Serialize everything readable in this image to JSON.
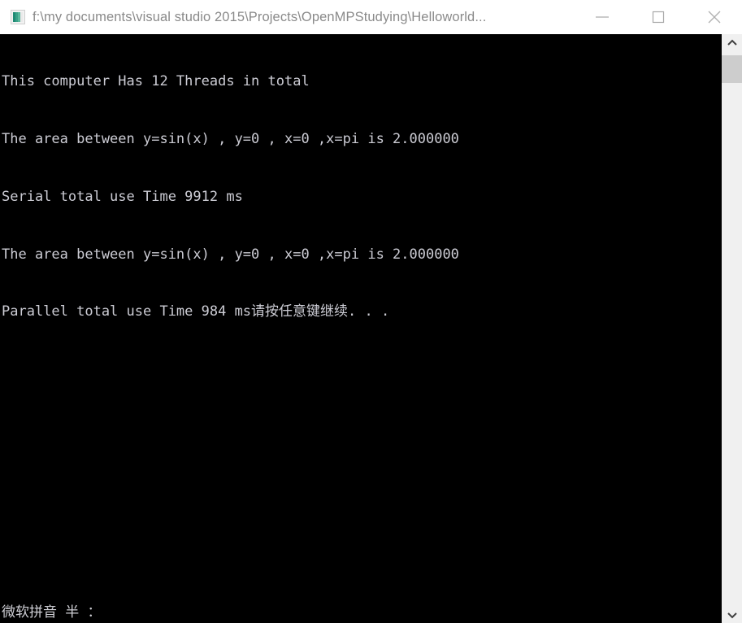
{
  "window": {
    "title": "f:\\my documents\\visual studio 2015\\Projects\\OpenMPStudying\\Helloworld...",
    "icon": "console-app-icon",
    "controls": {
      "minimize": "minimize-icon",
      "maximize": "maximize-icon",
      "close": "close-icon"
    },
    "background_color": "#000000",
    "titlebar_color": "#ffffff",
    "title_text_color": "#8a8a8a"
  },
  "console": {
    "text_color": "#ccccd4",
    "lines": [
      "This computer Has 12 Threads in total",
      "The area between y=sin(x) , y=0 , x=0 ,x=pi is 2.000000",
      "Serial total use Time 9912 ms",
      "The area between y=sin(x) , y=0 , x=0 ,x=pi is 2.000000",
      "Parallel total use Time 984 ms请按任意键继续. . ."
    ],
    "values": {
      "thread_count": "12",
      "serial_area": "2.000000",
      "serial_time_ms": "9912",
      "parallel_area": "2.000000",
      "parallel_time_ms": "984",
      "press_any_key": "请按任意键继续. . ."
    },
    "ime_status": "微软拼音 半 ："
  },
  "scrollbar": {
    "up_arrow": "chevron-up-icon",
    "down_arrow": "chevron-down-icon",
    "track_color": "#f0f0f0",
    "thumb_color": "#cdcdcd"
  }
}
